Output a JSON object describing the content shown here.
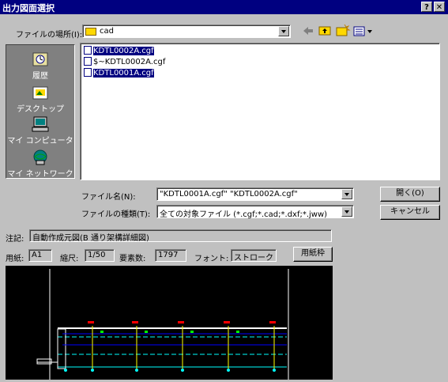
{
  "window": {
    "title": "出力図面選択",
    "help_btn": "?",
    "close_btn": "✕"
  },
  "location": {
    "label": "ファイルの場所(I):",
    "value": "cad"
  },
  "places": [
    {
      "label": "履歴",
      "icon": "history-icon"
    },
    {
      "label": "デスクトップ",
      "icon": "desktop-icon"
    },
    {
      "label": "マイ コンピュータ",
      "icon": "my-computer-icon"
    },
    {
      "label": "マイ ネットワーク",
      "icon": "network-icon"
    }
  ],
  "files": [
    {
      "name": "KDTL0002A.cgf",
      "selected": true
    },
    {
      "name": "$~KDTL0002A.cgf",
      "selected": false
    },
    {
      "name": "KDTL0001A.cgf",
      "selected": true
    }
  ],
  "filename": {
    "label": "ファイル名(N):",
    "value": "\"KDTL0001A.cgf\" \"KDTL0002A.cgf\""
  },
  "filetype": {
    "label": "ファイルの種類(T):",
    "value": "全ての対象ファイル (*.cgf;*.cad;*.dxf;*.jww)"
  },
  "buttons": {
    "open": "開く(O)",
    "cancel": "キャンセル",
    "paper": "用紙枠"
  },
  "note": {
    "label": "注記:",
    "value": "自動作成元図(B 通り架構詳細図)"
  },
  "meta": {
    "paper_label": "用紙:",
    "paper_value": "A1",
    "scale_label": "縮尺:",
    "scale_value": "1/50",
    "elements_label": "要素数:",
    "elements_value": "1797",
    "font_label": "フォント:",
    "font_value": "ストローク"
  }
}
